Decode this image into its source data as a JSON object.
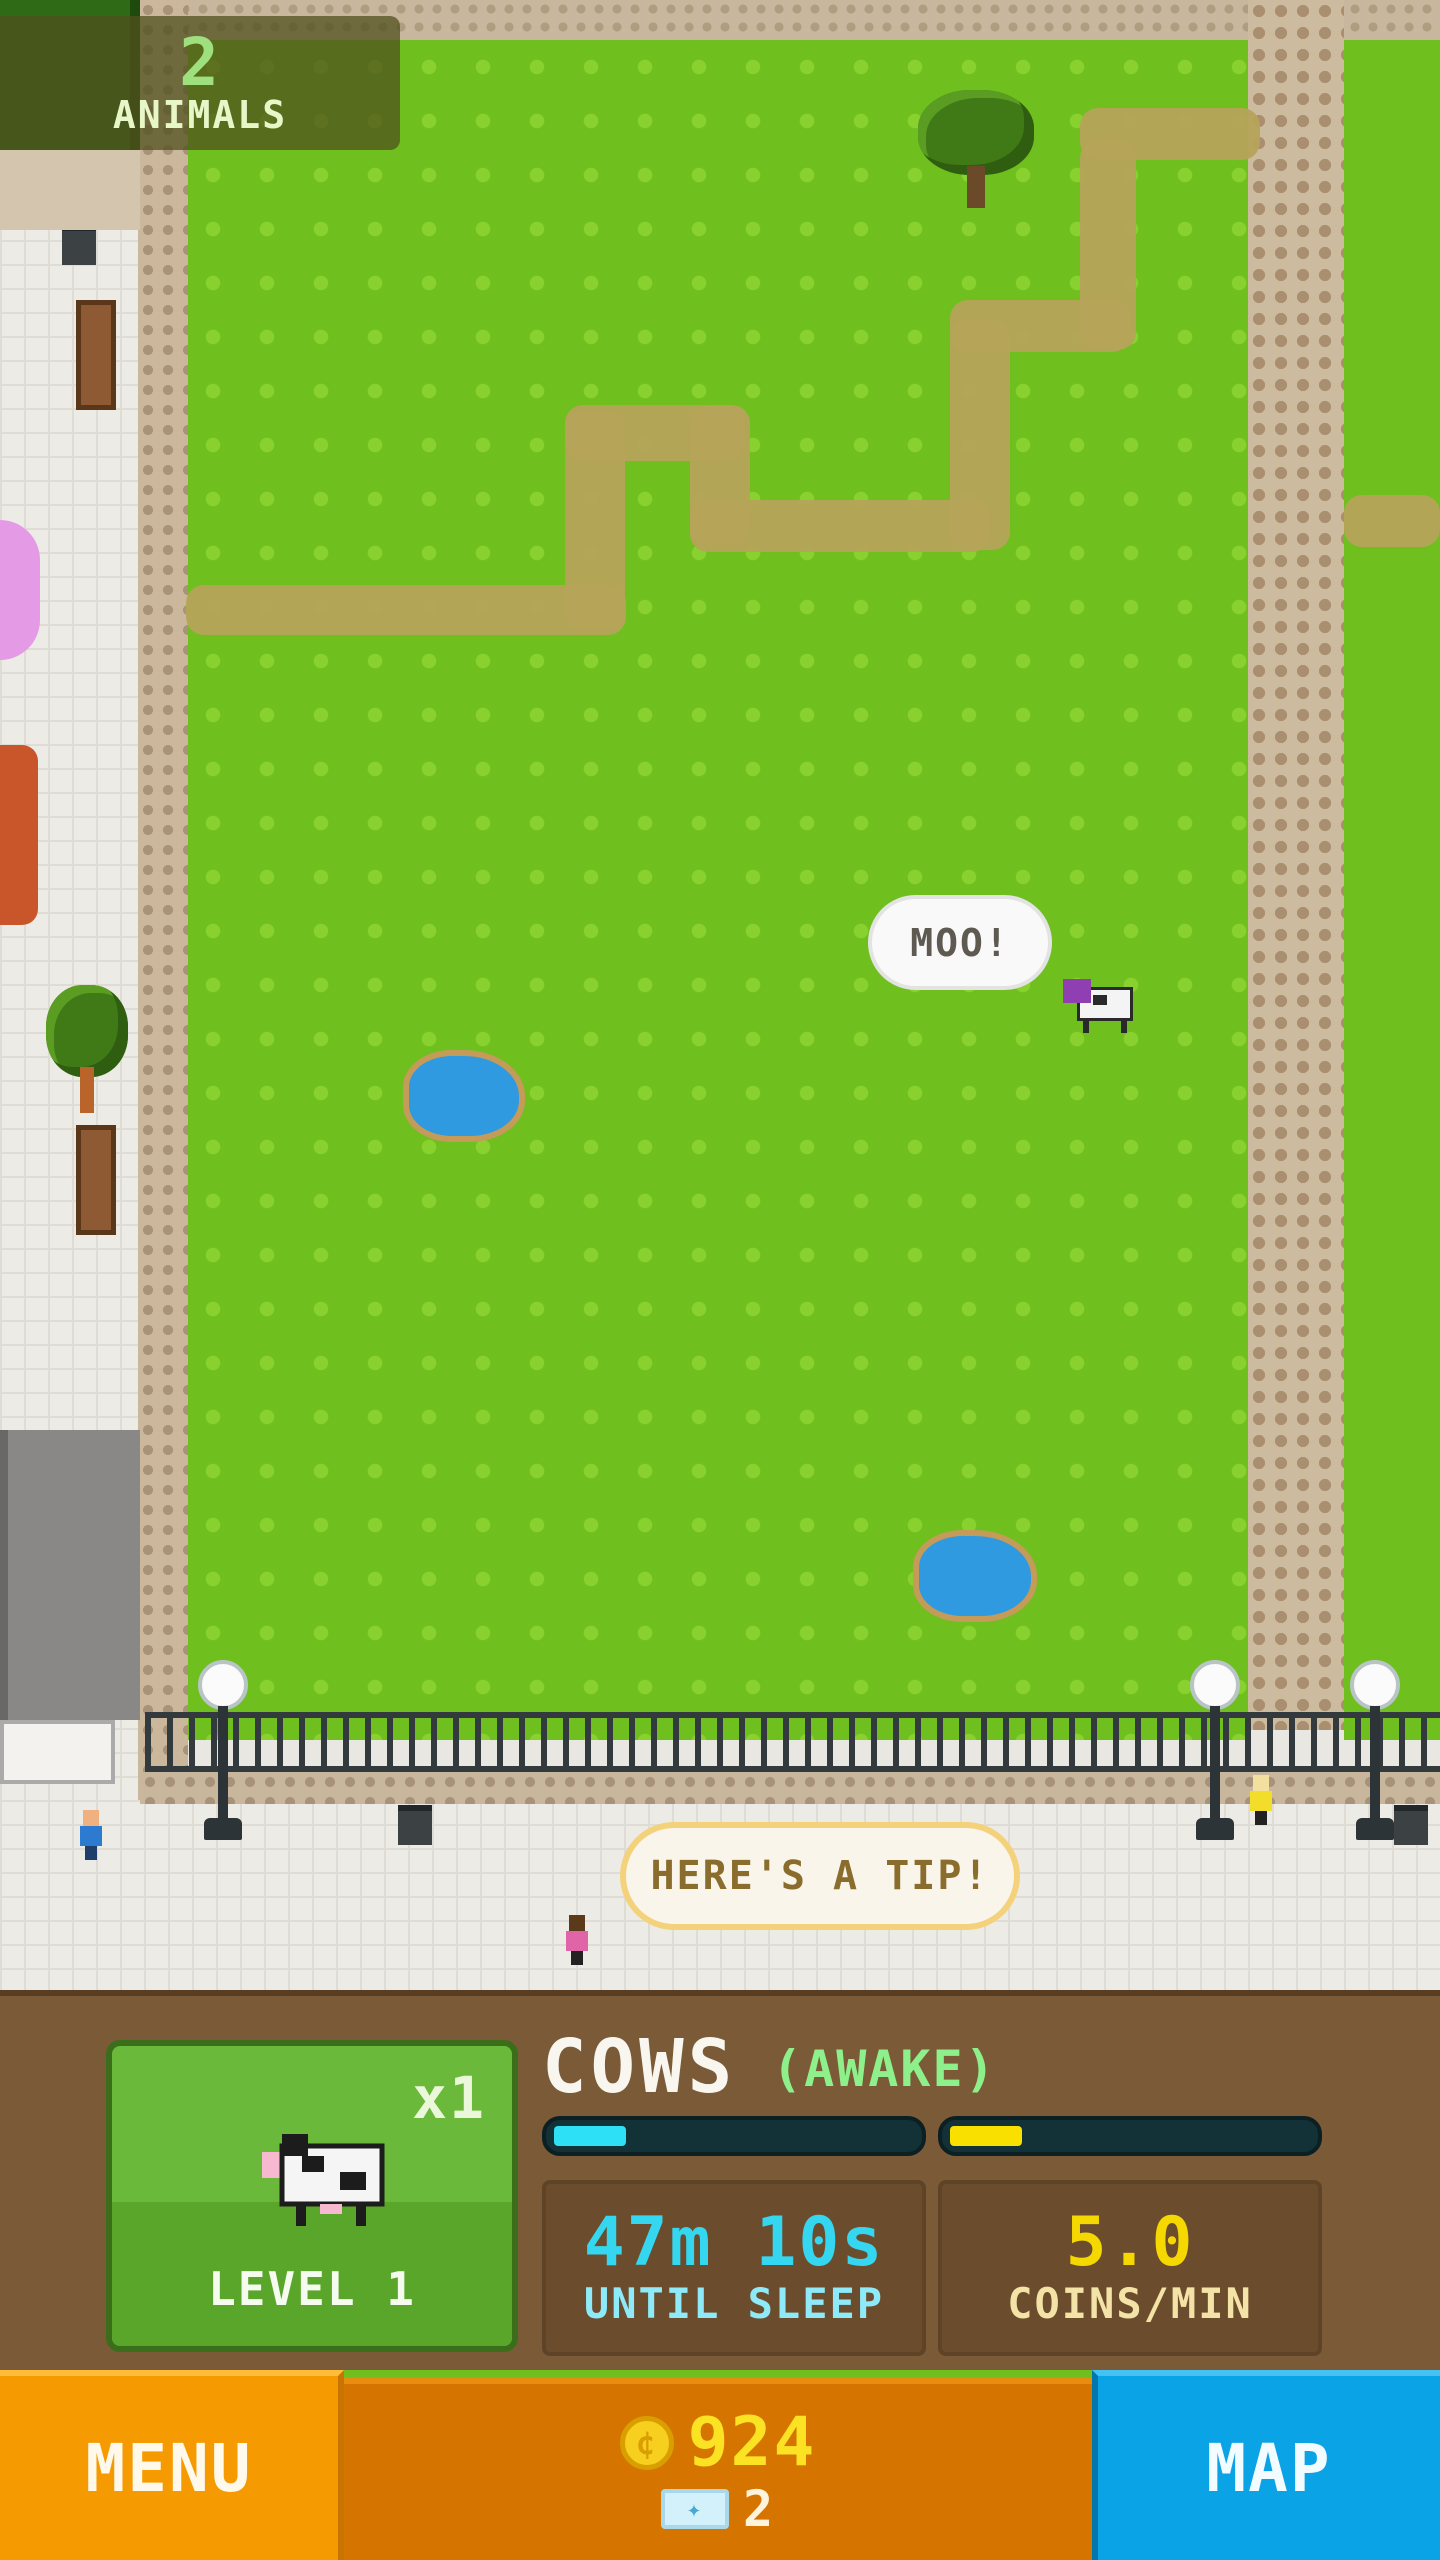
{
  "hud": {
    "animals_count": "2",
    "animals_label": "ANIMALS"
  },
  "world": {
    "cow_speech": "MOO!",
    "tip_bubble": "HERE'S A TIP!"
  },
  "panel": {
    "multiplier": "x1",
    "level_label": "LEVEL 1",
    "title": "COWS",
    "status": "(AWAKE)",
    "sleep_progress": 0.2,
    "coins_progress": 0.2,
    "sleep_time": "47m 10s",
    "sleep_caption": "UNTIL SLEEP",
    "coins_rate": "5.0",
    "coins_caption": "COINS/MIN"
  },
  "nav": {
    "menu_label": "MENU",
    "coins": "924",
    "tickets": "2",
    "map_label": "MAP"
  },
  "colors": {
    "grass": "#6fbf1f",
    "menu_button": "#f59a00",
    "map_button": "#0aa3e6",
    "sleep_bar": "#2ee0f5",
    "coins_bar": "#f9e000"
  },
  "icons": [
    "coin-icon",
    "ticket-icon",
    "cow-icon"
  ]
}
